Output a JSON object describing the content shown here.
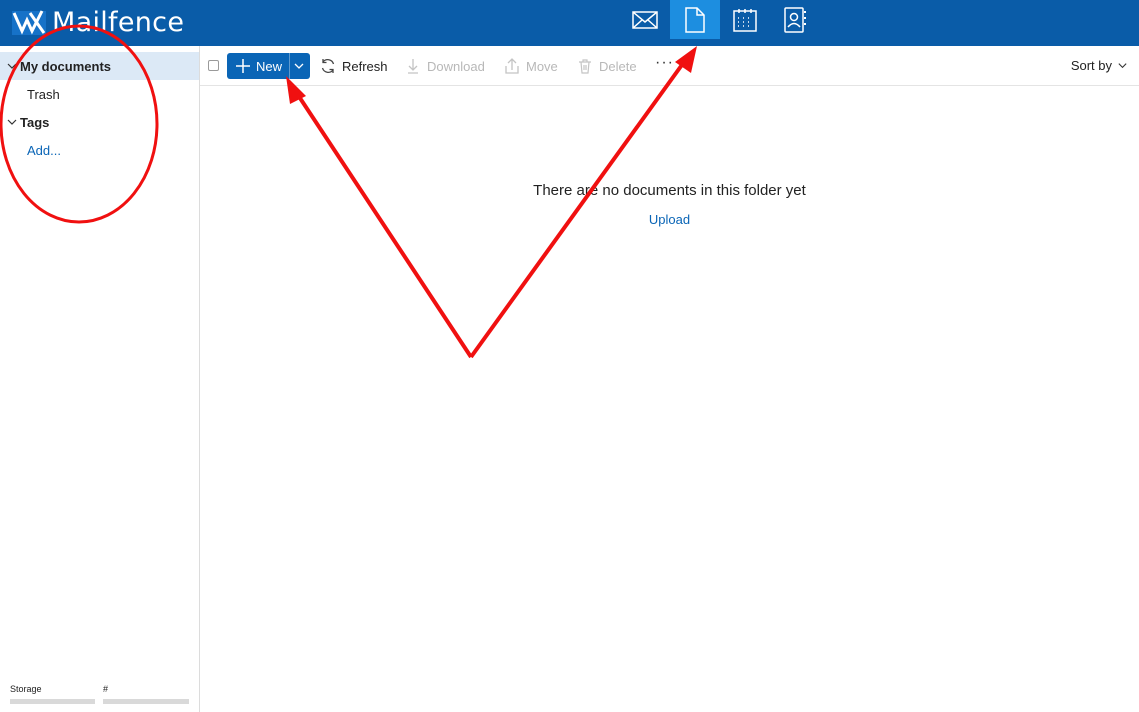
{
  "brand": {
    "name": "Mailfence"
  },
  "app_icons": [
    {
      "name": "mail-icon",
      "active": false
    },
    {
      "name": "documents-icon",
      "active": true
    },
    {
      "name": "calendar-icon",
      "active": false
    },
    {
      "name": "contacts-icon",
      "active": false
    }
  ],
  "sidebar": {
    "items": [
      {
        "label": "My documents"
      },
      {
        "label": "Trash"
      },
      {
        "label": "Tags"
      },
      {
        "label": "Add..."
      }
    ],
    "storage_label": "Storage",
    "count_label": "#"
  },
  "toolbar": {
    "new_label": "New",
    "refresh_label": "Refresh",
    "download_label": "Download",
    "move_label": "Move",
    "delete_label": "Delete",
    "more_label": "···",
    "sort_label": "Sort by"
  },
  "main": {
    "empty_message": "There are no documents in this folder yet",
    "upload_label": "Upload"
  },
  "colors": {
    "topbar": "#0a5ca8",
    "accent": "#0a65b6",
    "active_app": "#1d8ee0",
    "selected_row": "#dce9f6",
    "annotation": "#f01010"
  }
}
